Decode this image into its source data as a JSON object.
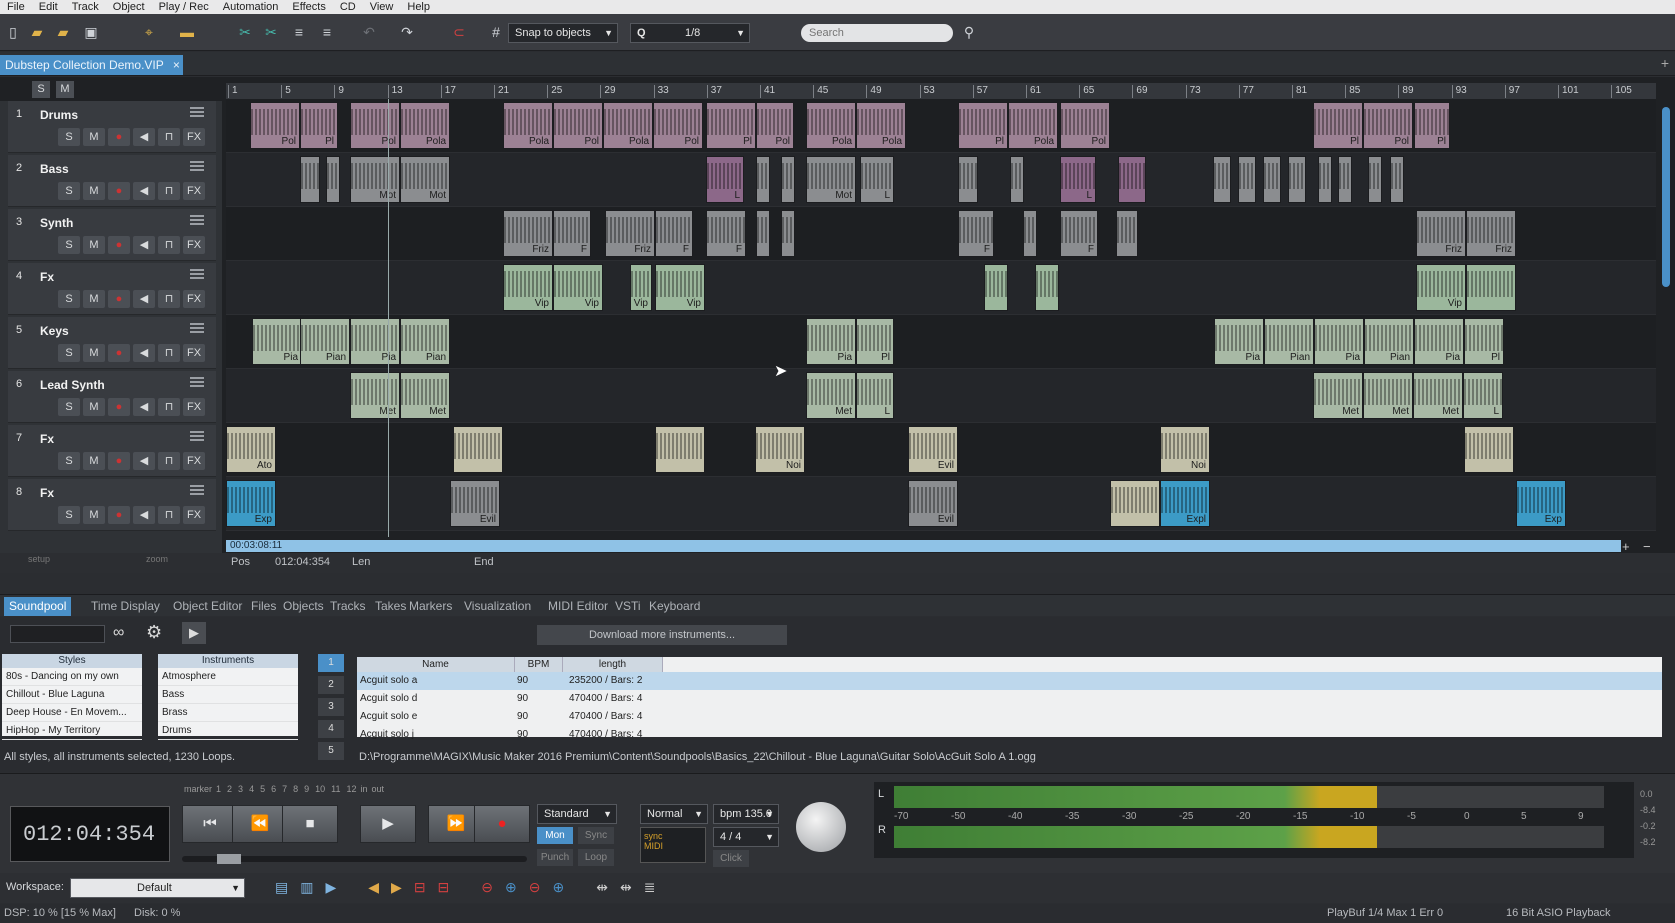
{
  "menu": [
    "File",
    "Edit",
    "Track",
    "Object",
    "Play / Rec",
    "Automation",
    "Effects",
    "CD",
    "View",
    "Help"
  ],
  "toolbar": {
    "snap_label": "Snap to objects",
    "quantize_label": "Q",
    "quantize_value": "1/8",
    "search_placeholder": "Search"
  },
  "project_tab": "Dubstep Collection Demo.VIP",
  "ruler": [
    "1",
    "5",
    "9",
    "13",
    "17",
    "21",
    "25",
    "29",
    "33",
    "37",
    "41",
    "45",
    "49",
    "53",
    "57",
    "61",
    "65",
    "69",
    "73",
    "77",
    "81",
    "85",
    "89",
    "93",
    "97",
    "101",
    "105"
  ],
  "tracks": [
    {
      "num": "1",
      "name": "Drums"
    },
    {
      "num": "2",
      "name": "Bass"
    },
    {
      "num": "3",
      "name": "Synth"
    },
    {
      "num": "4",
      "name": "Fx"
    },
    {
      "num": "5",
      "name": "Keys"
    },
    {
      "num": "6",
      "name": "Lead Synth"
    },
    {
      "num": "7",
      "name": "Fx"
    },
    {
      "num": "8",
      "name": "Fx"
    }
  ],
  "track_buttons": [
    "S",
    "M",
    "FX"
  ],
  "clips": [
    [
      "Pol",
      "Pl",
      "Pol",
      "Pola",
      "Pola",
      "Pol",
      "Pola",
      "Pol",
      "Pl",
      "Pol",
      "Pola",
      "Pola",
      "Pl",
      "Pola",
      "Pol",
      "Pl",
      "Pol",
      "Pl"
    ],
    [
      "Mot",
      "Mot",
      "L",
      "Mot",
      "L",
      "L"
    ],
    [
      "Friz",
      "F",
      "Friz",
      "F",
      "F",
      "F",
      "F",
      "Friz",
      "Friz"
    ],
    [
      "Vip",
      "Vip",
      "Vip",
      "Vip",
      "Vip"
    ],
    [
      "Pia",
      "Pian",
      "Pia",
      "Pian",
      "Pia",
      "Pl",
      "Pia",
      "Pian",
      "Pia",
      "Pian",
      "Pia",
      "Pl"
    ],
    [
      "Met",
      "Met",
      "Met",
      "L",
      "Met",
      "Met",
      "Met",
      "L"
    ],
    [
      "Ato",
      "Noi",
      "Evil",
      "Noi"
    ],
    [
      "Exp",
      "Evil",
      "Evil",
      "Expl",
      "Exp"
    ]
  ],
  "timeline_time": "00:03:08:11",
  "posbar": {
    "pos_label": "Pos",
    "pos_value": "012:04:354",
    "len_label": "Len",
    "end_label": "End",
    "setup": "setup",
    "zoom": "zoom"
  },
  "lower_tabs": [
    "Soundpool",
    "Time Display",
    "Object Editor",
    "Files",
    "Objects",
    "Tracks",
    "Takes",
    "Markers",
    "Visualization",
    "MIDI Editor",
    "VSTi",
    "Keyboard"
  ],
  "soundpool": {
    "download_label": "Download more instruments...",
    "styles_header": "Styles",
    "styles": [
      "80s - Dancing on my own",
      "Chillout - Blue Laguna",
      "Deep House - En Movem...",
      "HipHop - My Territory"
    ],
    "instruments_header": "Instruments",
    "instruments": [
      "Atmosphere",
      "Bass",
      "Brass",
      "Drums"
    ],
    "pages": [
      "1",
      "2",
      "3",
      "4",
      "5"
    ],
    "columns": [
      "Name",
      "BPM",
      "length"
    ],
    "rows": [
      {
        "name": "Acguit solo a",
        "bpm": "90",
        "length": "235200 / Bars: 2"
      },
      {
        "name": "Acguit solo d",
        "bpm": "90",
        "length": "470400 / Bars: 4"
      },
      {
        "name": "Acguit solo e",
        "bpm": "90",
        "length": "470400 / Bars: 4"
      },
      {
        "name": "Acguit solo j",
        "bpm": "90",
        "length": "470400 / Bars: 4"
      }
    ],
    "status": "All styles, all instruments selected, 1230 Loops.",
    "path": "D:\\Programme\\MAGIX\\Music Maker 2016 Premium\\Content\\Soundpools\\Basics_22\\Chillout - Blue Laguna\\Guitar Solo\\AcGuit Solo A 1.ogg"
  },
  "transport": {
    "time": "012:04:354",
    "marker_label": "marker",
    "marker_nums": [
      "1",
      "2",
      "3",
      "4",
      "5",
      "6",
      "7",
      "8",
      "9",
      "10",
      "11",
      "12"
    ],
    "in": "in",
    "out": "out",
    "standard": "Standard",
    "normal": "Normal",
    "bpm": "bpm 135.0",
    "sig": "4 / 4",
    "mon": "Mon",
    "sync": "Sync",
    "punch": "Punch",
    "loop": "Loop",
    "click": "Click",
    "midi": "MIDI"
  },
  "meter": {
    "L": "L",
    "R": "R",
    "scale": [
      "-70",
      "-50",
      "-40",
      "-35",
      "-30",
      "-25",
      "-20",
      "-15",
      "-10",
      "-5",
      "0",
      "5",
      "9"
    ],
    "right_vals": [
      "0.0",
      "-8.4",
      "-0.2",
      "-8.2"
    ]
  },
  "workspace": {
    "label": "Workspace:",
    "value": "Default"
  },
  "status": {
    "dsp": "DSP: 10 % [15 % Max]",
    "disk": "Disk: 0 %",
    "playbuf": "PlayBuf 1/4 Max 1 Err 0",
    "asio": "16 Bit ASIO Playback"
  }
}
